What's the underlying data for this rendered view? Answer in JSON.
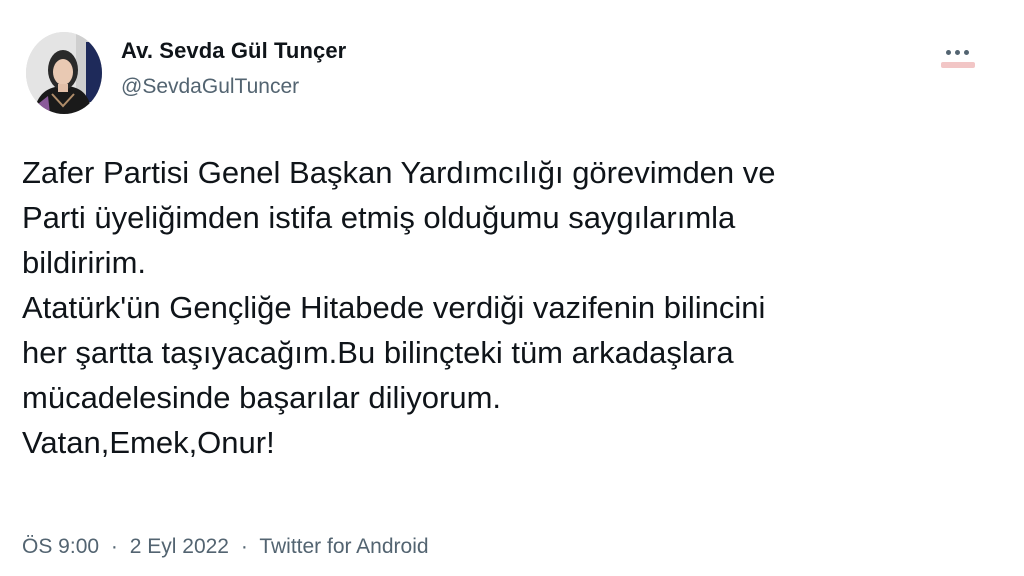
{
  "author": {
    "display_name": "Av. Sevda Gül Tunçer",
    "handle": "@SevdaGulTuncer",
    "avatar_icon": "profile-photo"
  },
  "more_icon": "more-options-icon",
  "tweet": {
    "lines": [
      "Zafer Partisi Genel Başkan Yardımcılığı görevimden ve",
      "Parti üyeliğimden istifa etmiş olduğumu saygılarımla",
      "bildiririm.",
      "Atatürk'ün Gençliğe Hitabede verdiği vazifenin bilincini",
      "her şartta taşıyacağım.Bu bilinçteki tüm arkadaşlara",
      "mücadelesinde başarılar diliyorum.",
      "Vatan,Emek,Onur!"
    ]
  },
  "meta": {
    "time": "ÖS 9:00",
    "separator": "·",
    "date": "2 Eyl 2022",
    "source": "Twitter for Android"
  },
  "colors": {
    "text": "#0f1419",
    "secondary": "#536471",
    "background": "#ffffff"
  }
}
